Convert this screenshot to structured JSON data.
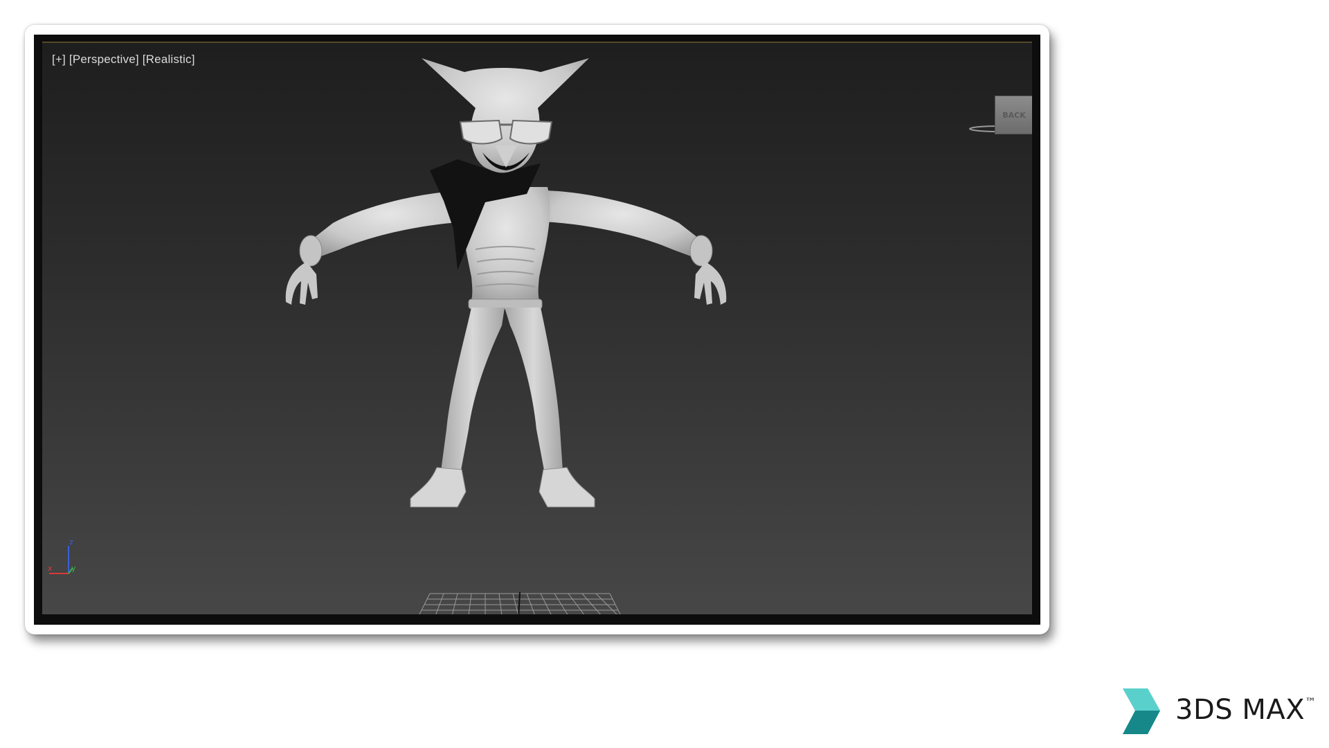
{
  "viewport": {
    "label_plus": "[+]",
    "label_view": "[Perspective]",
    "label_shading": "[Realistic]",
    "viewcube_face": "BACK",
    "axis_x": "x",
    "axis_y": "y",
    "axis_z": "z",
    "icons": [
      "viewcube-icon",
      "axis-tripod-icon",
      "ground-grid"
    ]
  },
  "brand": {
    "name": "3DS MAX",
    "trademark": "™",
    "logo_color": "#2bb3b3"
  }
}
